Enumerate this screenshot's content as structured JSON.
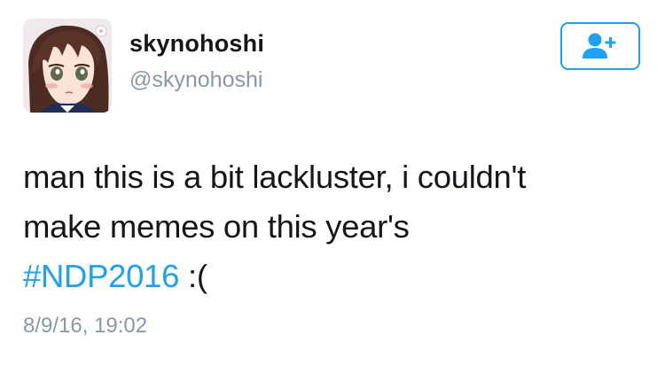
{
  "user": {
    "display_name": "skynohoshi",
    "handle": "@skynohoshi"
  },
  "follow_button": {
    "icon": "add-user-icon"
  },
  "tweet": {
    "text_line1": "man this is a bit lackluster, i couldn't",
    "text_line2": "make memes on this year's",
    "hashtag": "#NDP2016",
    "text_after_hashtag": " :(",
    "timestamp": "8/9/16, 19:02"
  },
  "colors": {
    "accent": "#1da1f2",
    "text": "#14171a",
    "muted": "#8899a6"
  }
}
